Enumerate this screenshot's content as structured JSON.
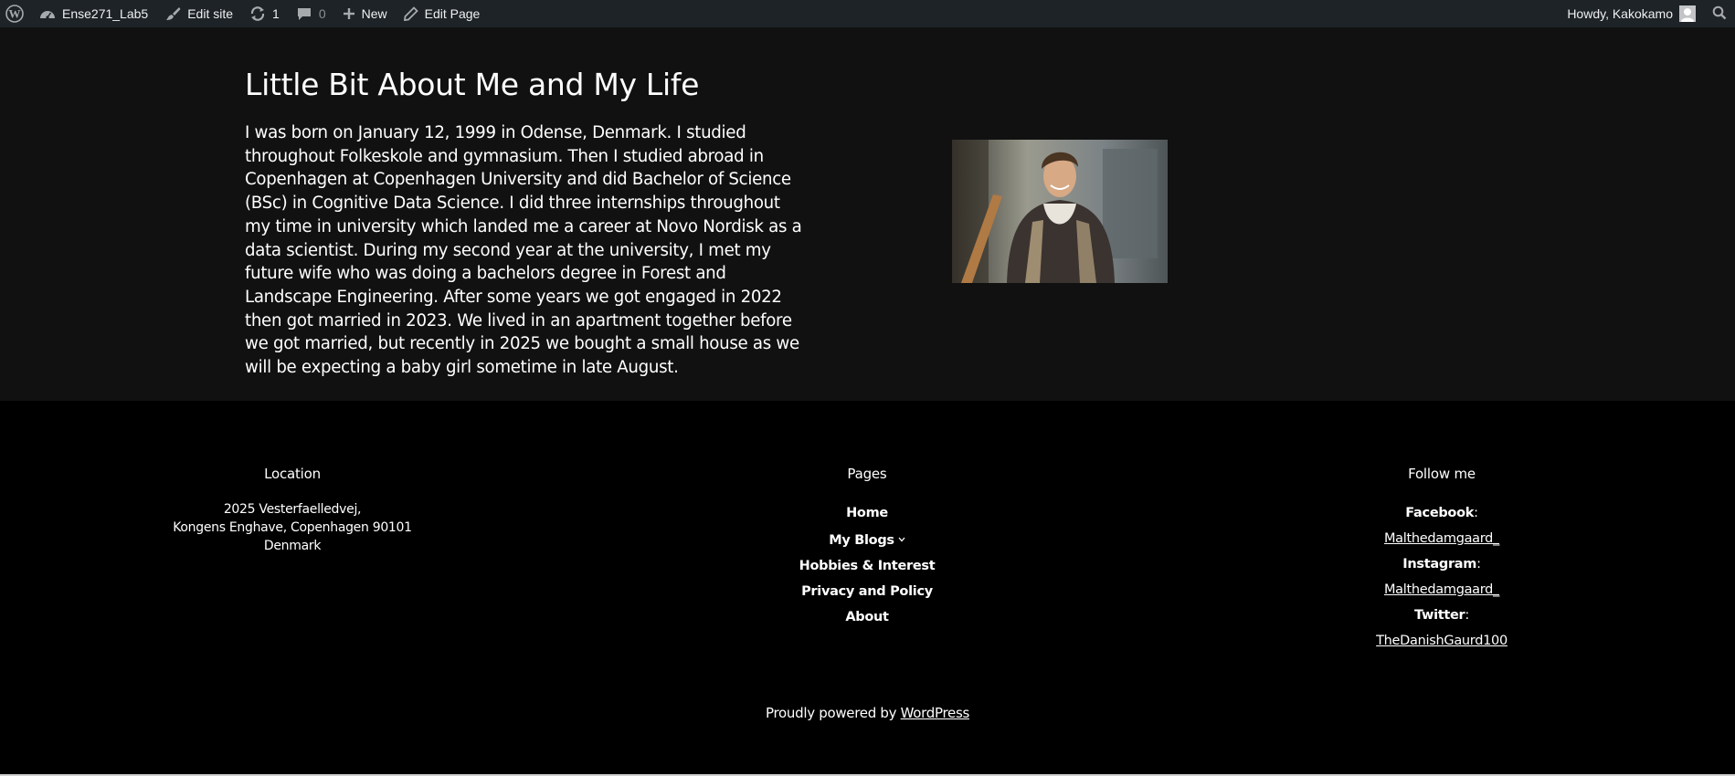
{
  "admin_bar": {
    "site_name": "Ense271_Lab5",
    "edit_site": "Edit site",
    "updates_count": "1",
    "comments_count": "0",
    "new_label": "New",
    "edit_page": "Edit Page",
    "howdy": "Howdy, Kakokamo"
  },
  "content": {
    "title": "Little Bit About Me and My Life",
    "bio": "I was born on January 12, 1999 in Odense, Denmark. I studied throughout Folkeskole and gymnasium. Then I studied abroad in Copenhagen at Copenhagen University and did Bachelor of Science (BSc) in Cognitive Data Science. I did three internships throughout my time in university which landed me a career at Novo Nordisk as a data scientist. During my second year at the university, I met my future wife who was doing a bachelors degree in Forest and Landscape Engineering. After some years we got engaged in 2022 then got married in 2023. We lived in an apartment together before we got married, but recently in 2025 we bought a small house as we will be expecting a baby girl sometime in late August."
  },
  "footer": {
    "location": {
      "heading": "Location",
      "line1": "2025 Vesterfaelledvej,",
      "line2": "Kongens Enghave, Copenhagen 90101",
      "line3": "Denmark"
    },
    "pages": {
      "heading": "Pages",
      "items": [
        "Home",
        "My Blogs",
        "Hobbies & Interest",
        "Privacy and Policy",
        "About"
      ]
    },
    "follow": {
      "heading": "Follow me",
      "facebook_label": "Facebook",
      "facebook_handle": "Malthedamgaard_",
      "instagram_label": "Instagram",
      "instagram_handle": "Malthedamgaard_",
      "twitter_label": "Twitter",
      "twitter_handle": "TheDanishGaurd100"
    },
    "powered_prefix": "Proudly powered by ",
    "powered_link": "WordPress"
  },
  "colors": {
    "admin_bar": "#1d2327",
    "content_bg": "#111111",
    "footer_bg": "#000000",
    "text": "#ffffff"
  }
}
